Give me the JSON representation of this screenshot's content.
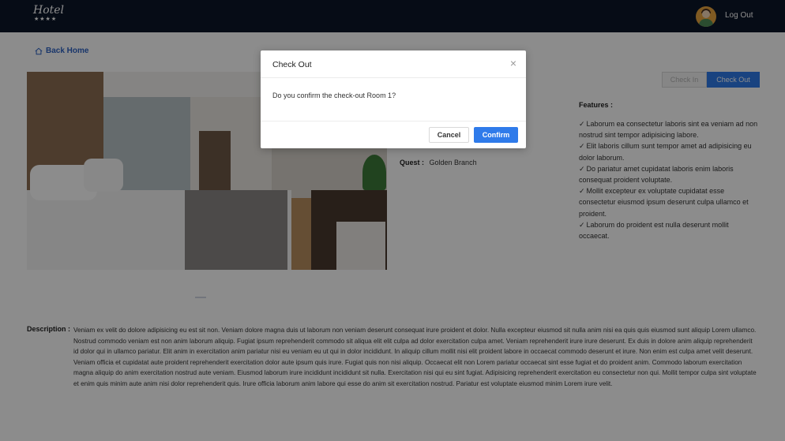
{
  "header": {
    "logo_text": "Hotel",
    "logo_stars": "★★★★",
    "logout_label": "Log Out"
  },
  "nav": {
    "back_label": "Back Home"
  },
  "room": {
    "guest_label": "Quest :",
    "guest_value": "Golden Branch",
    "checkin_label": "Check In",
    "checkout_label": "Check Out",
    "features_title": "Features :",
    "features": [
      "Laborum ea consectetur laboris sint ea veniam ad non nostrud sint tempor adipisicing labore.",
      "Elit laboris cillum sunt tempor amet ad adipisicing eu dolor laborum.",
      "Do pariatur amet cupidatat laboris enim laboris consequat proident voluptate.",
      "Mollit excepteur ex voluptate cupidatat esse consectetur eiusmod ipsum deserunt culpa ullamco et proident.",
      "Laborum do proident est nulla deserunt mollit occaecat."
    ],
    "check_glyph": "✓",
    "description_label": "Description :",
    "description": "Veniam ex velit do dolore adipisicing eu est sit non. Veniam dolore magna duis ut laborum non veniam deserunt consequat irure proident et dolor. Nulla excepteur eiusmod sit nulla anim nisi ea quis quis eiusmod sunt aliquip Lorem ullamco. Nostrud commodo veniam est non anim laborum aliquip. Fugiat ipsum reprehenderit commodo sit aliqua elit elit culpa ad dolor exercitation culpa amet. Veniam reprehenderit irure irure deserunt. Ex duis in dolore anim aliquip reprehenderit id dolor qui in ullamco pariatur. Elit anim in exercitation anim pariatur nisi eu veniam eu ut qui in dolor incididunt. In aliquip cillum mollit nisi elit proident labore in occaecat commodo deserunt et irure. Non enim est culpa amet velit deserunt. Veniam officia et cupidatat aute proident reprehenderit exercitation dolor aute ipsum quis irure. Fugiat quis non nisi aliquip. Occaecat elit non Lorem pariatur occaecat sint esse fugiat et do proident anim. Commodo laborum exercitation magna aliquip do anim exercitation nostrud aute veniam. Eiusmod laborum irure incididunt incididunt sit nulla. Exercitation nisi qui eu sint fugiat. Adipisicing reprehenderit exercitation eu consectetur non qui. Mollit tempor culpa sint voluptate et enim quis minim aute anim nisi dolor reprehenderit quis. Irure officia laborum anim labore qui esse do anim sit exercitation nostrud. Pariatur est voluptate eiusmod minim Lorem irure velit."
  },
  "modal": {
    "title": "Check Out",
    "close_glyph": "×",
    "message": "Do you confirm the check-out Room 1?",
    "cancel_label": "Cancel",
    "confirm_label": "Confirm"
  },
  "colors": {
    "header_bg": "#0b1628",
    "primary": "#2f7bea",
    "link": "#2f63c4",
    "overlay": "rgba(0,0,0,0.45)"
  },
  "icons": [
    "home-icon",
    "check-icon",
    "close-icon",
    "avatar"
  ]
}
